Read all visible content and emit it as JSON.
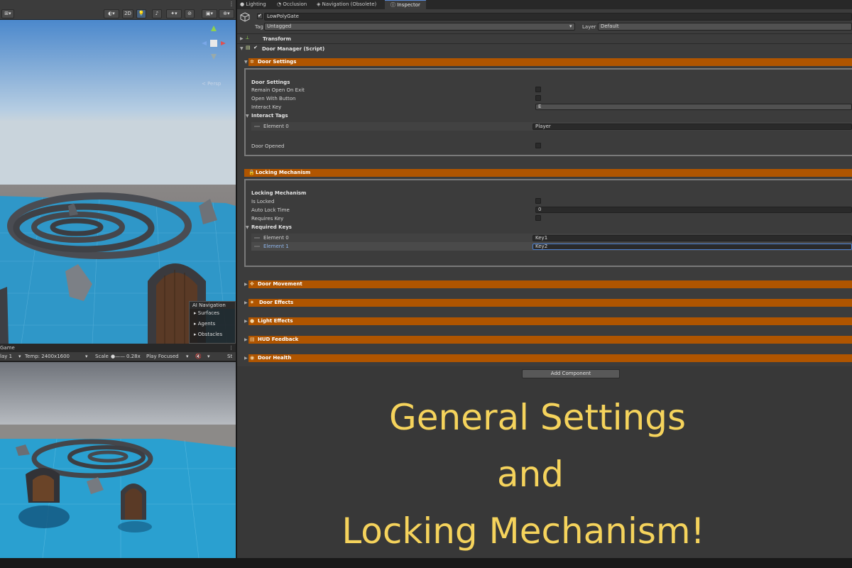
{
  "tabs": [
    {
      "label": "Lighting",
      "icon": "light-icon"
    },
    {
      "label": "Occlusion",
      "icon": "occlusion-icon"
    },
    {
      "label": "Navigation (Obsolete)",
      "icon": "navigation-icon"
    },
    {
      "label": "Inspector",
      "icon": "info-icon",
      "active": true
    }
  ],
  "scene": {
    "toolbar_2d": "2D",
    "persp_label": "< Persp",
    "ai_nav": {
      "title": "AI Navigation",
      "items": [
        "Surfaces",
        "Agents",
        "Obstacles"
      ]
    }
  },
  "game": {
    "tab_label": "Game",
    "display": "lay 1",
    "resolution": "Temp: 2400x1600",
    "scale_label": "Scale",
    "scale_value": "0.28x",
    "play_mode": "Play Focused",
    "stats": "St"
  },
  "inspector": {
    "object_name": "LowPolyGate",
    "tag_label": "Tag",
    "tag_value": "Untagged",
    "layer_label": "Layer",
    "layer_value": "Default",
    "transform_label": "Transform",
    "script_label": "Door Manager (Script)",
    "door_settings": {
      "header": "Door Settings",
      "subheader": "Door Settings",
      "remain_open": "Remain Open On Exit",
      "open_with_button": "Open With Button",
      "interact_key_label": "Interact Key",
      "interact_key_value": "E",
      "interact_tags_label": "Interact Tags",
      "tags": [
        {
          "label": "Element 0",
          "value": "Player"
        }
      ],
      "door_opened": "Door Opened"
    },
    "locking": {
      "header": "Locking Mechanism",
      "subheader": "Locking Mechanism",
      "is_locked": "Is Locked",
      "auto_lock_time_label": "Auto Lock Time",
      "auto_lock_time_value": "0",
      "requires_key": "Requires Key",
      "required_keys_label": "Required Keys",
      "keys": [
        {
          "label": "Element 0",
          "value": "Key1"
        },
        {
          "label": "Element 1",
          "value": "Key2"
        }
      ]
    },
    "collapsed_sections": [
      {
        "label": "Door Movement",
        "icon": "move-icon"
      },
      {
        "label": "Door Effects",
        "icon": "effects-icon"
      },
      {
        "label": "Light Effects",
        "icon": "bulb-icon"
      },
      {
        "label": "HUD Feedback",
        "icon": "hud-icon"
      },
      {
        "label": "Door Health",
        "icon": "health-icon"
      }
    ],
    "add_component": "Add Component"
  },
  "overlay": {
    "lines": [
      "General Settings",
      "and",
      "Locking Mechanism!"
    ]
  },
  "colors": {
    "section_header": "#b05500",
    "overlay_text": "#f5d35c",
    "inspector_bg": "#3c3c3c"
  }
}
